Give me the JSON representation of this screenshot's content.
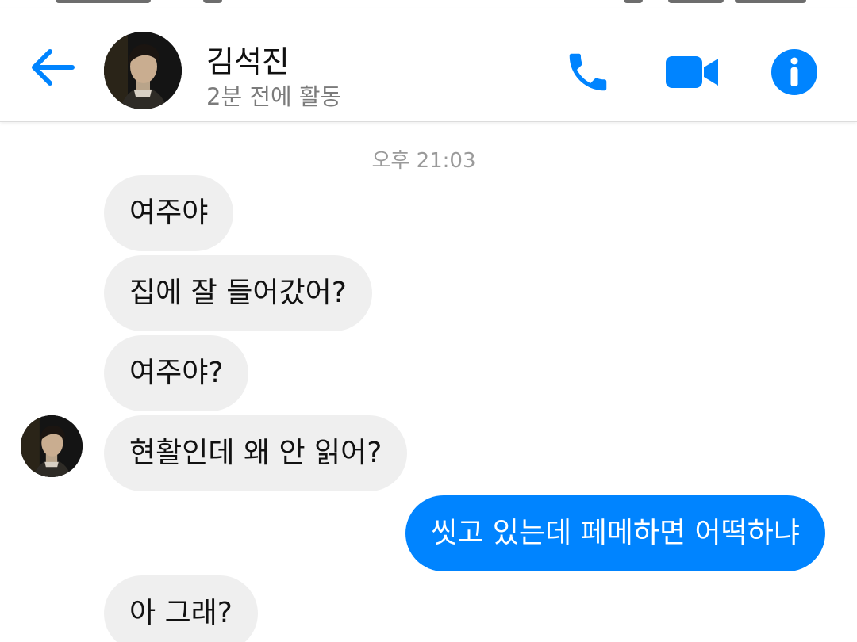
{
  "header": {
    "contact_name": "김석진",
    "contact_status": "2분 전에 활동",
    "icons": {
      "back": "back-arrow-icon",
      "call": "phone-icon",
      "video": "video-camera-icon",
      "info": "info-icon"
    },
    "accent_color": "#0084ff"
  },
  "conversation": {
    "timestamp": "오후 21:03",
    "messages": [
      {
        "sender": "contact",
        "text": "여주야"
      },
      {
        "sender": "contact",
        "text": "집에 잘 들어갔어?"
      },
      {
        "sender": "contact",
        "text": "여주야?"
      },
      {
        "sender": "contact",
        "text": "현활인데 왜 안 읽어?"
      },
      {
        "sender": "me",
        "text": "씻고 있는데 페메하면 어떡하냐"
      },
      {
        "sender": "contact",
        "text": "아 그래?"
      }
    ]
  },
  "colors": {
    "incoming_bubble": "#efefef",
    "outgoing_bubble": "#0084ff",
    "timestamp_text": "#9a9a9a",
    "status_text": "#7b7b7b"
  }
}
